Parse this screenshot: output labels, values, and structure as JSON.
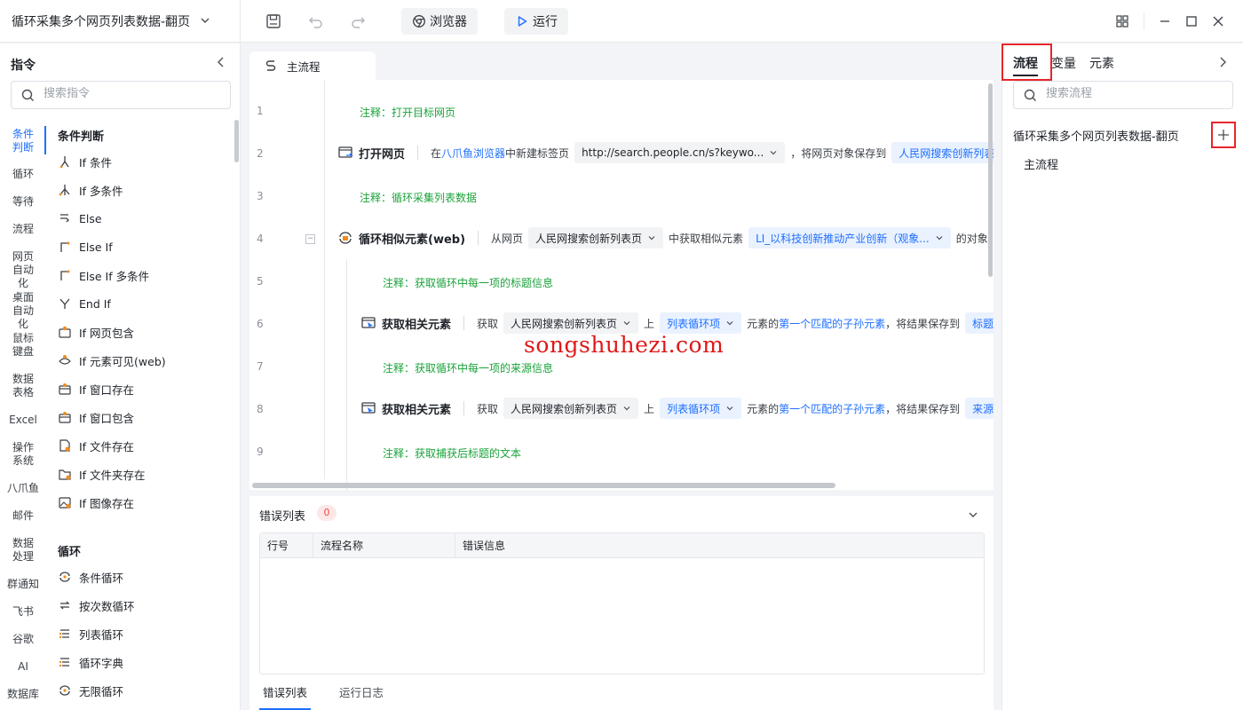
{
  "app": {
    "title": "循环采集多个网页列表数据-翻页",
    "browser_label": "浏览器",
    "run_label": "运行"
  },
  "left_panel": {
    "title": "指令",
    "search_placeholder": "搜索指令",
    "categories": [
      "条件判断",
      "循环",
      "等待",
      "流程",
      "网页自动化",
      "桌面自动化",
      "鼠标键盘",
      "数据表格",
      "Excel",
      "操作系统",
      "八爪鱼",
      "邮件",
      "数据处理",
      "群通知",
      "飞书",
      "谷歌",
      "AI",
      "数据库"
    ],
    "groups": [
      {
        "title": "条件判断",
        "items": [
          "If 条件",
          "If 多条件",
          "Else",
          "Else If",
          "Else If 多条件",
          "End If",
          "If 网页包含",
          "If 元素可见(web)",
          "If 窗口存在",
          "If 窗口包含",
          "If 文件存在",
          "If 文件夹存在",
          "If 图像存在"
        ]
      },
      {
        "title": "循环",
        "items": [
          "条件循环",
          "按次数循环",
          "列表循环",
          "循环字典",
          "无限循环"
        ]
      }
    ]
  },
  "editor": {
    "tab_label": "主流程",
    "line_numbers": [
      "1",
      "2",
      "3",
      "4",
      "5",
      "6",
      "7",
      "8",
      "9"
    ],
    "rows": {
      "r1_comment": "注释：打开目标网页",
      "r2": {
        "name": "打开网页",
        "t1": "在",
        "link1": "八爪鱼浏览器",
        "t2": "中新建标签页",
        "pill_url": "http://search.people.cn/s?keywo...",
        "t3": "，将网页对象保存到",
        "pill_var": "人民网搜索创新列表页"
      },
      "r3_comment": "注释：循环采集列表数据",
      "r4": {
        "name": "循环相似元素(web)",
        "t1": "从网页",
        "pill_page": "人民网搜索创新列表页",
        "t2": "中获取相似元素",
        "pill_el": "LI_以科技创新推动产业创新（观象...",
        "t3": "的对象，"
      },
      "r5_comment": "注释：获取循环中每一项的标题信息",
      "r6": {
        "name": "获取相关元素",
        "t1": "获取",
        "pill_page": "人民网搜索创新列表页",
        "t2": "上",
        "pill_loop": "列表循环项",
        "t3": "元素的",
        "link1": "第一个匹配的子孙元素",
        "t4": "，将结果保存到",
        "pill_var": "标题"
      },
      "r7_comment": "注释：获取循环中每一项的来源信息",
      "r8": {
        "name": "获取相关元素",
        "t1": "获取",
        "pill_page": "人民网搜索创新列表页",
        "t2": "上",
        "pill_loop": "列表循环项",
        "t3": "元素的",
        "link1": "第一个匹配的子孙元素",
        "t4": "，将结果保存到",
        "pill_var": "来源"
      },
      "r9_comment": "注释：获取捕获后标题的文本"
    }
  },
  "error_panel": {
    "title": "错误列表",
    "count": "0",
    "columns": [
      "行号",
      "流程名称",
      "错误信息"
    ],
    "tabs": [
      "错误列表",
      "运行日志"
    ]
  },
  "right_panel": {
    "tabs": [
      "流程",
      "变量",
      "元素"
    ],
    "search_placeholder": "搜索流程",
    "process_title": "循环采集多个网页列表数据-翻页",
    "sub_process": "主流程"
  },
  "watermark": "songshuhezi.com",
  "colors": {
    "accent": "#1e6fff",
    "comment": "#1aa33a",
    "highlight_red": "#e8262a"
  }
}
